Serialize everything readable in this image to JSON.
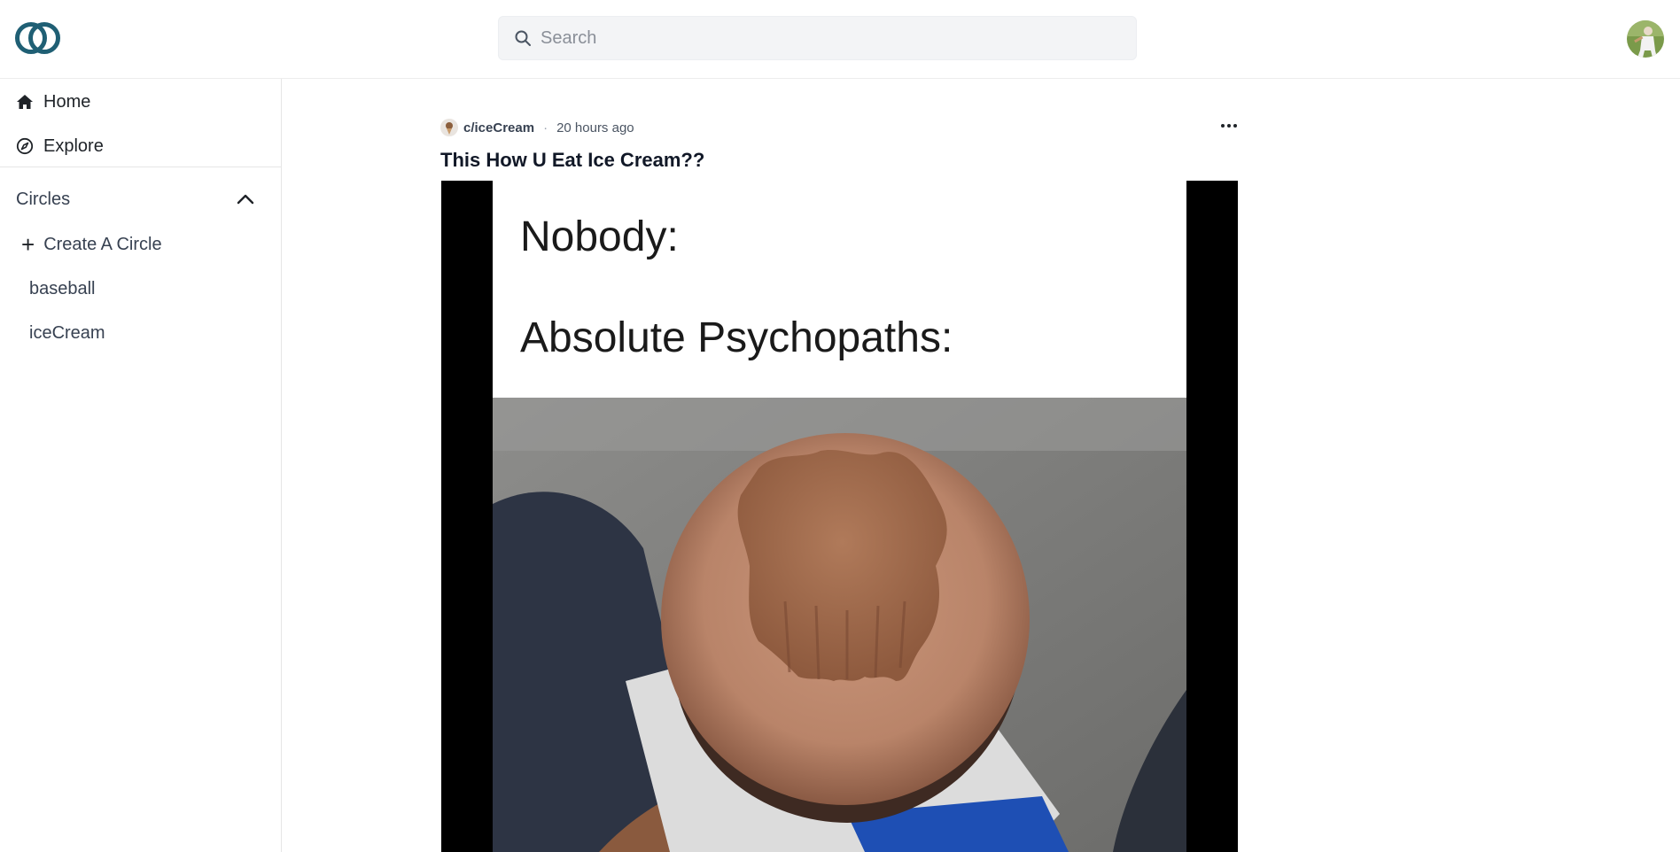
{
  "app": {
    "brand_color": "#1f5f74",
    "search": {
      "placeholder": "Search",
      "value": ""
    }
  },
  "sidebar": {
    "nav": [
      {
        "label": "Home",
        "icon": "home-icon"
      },
      {
        "label": "Explore",
        "icon": "compass-icon"
      }
    ],
    "circles_section": {
      "label": "Circles",
      "expanded": true,
      "toggle_icon": "chevron-up-icon"
    },
    "create_circle": {
      "label": "Create A Circle",
      "icon": "plus-icon"
    },
    "circles": [
      {
        "label": "baseball"
      },
      {
        "label": "iceCream"
      }
    ]
  },
  "post": {
    "circle": "c/iceCream",
    "separator": "·",
    "time": "20 hours ago",
    "title": "This How U Eat Ice Cream??",
    "menu_icon": "more-horizontal-icon",
    "meme": {
      "line1": "Nobody:",
      "line2": "Absolute Psychopaths:"
    }
  }
}
